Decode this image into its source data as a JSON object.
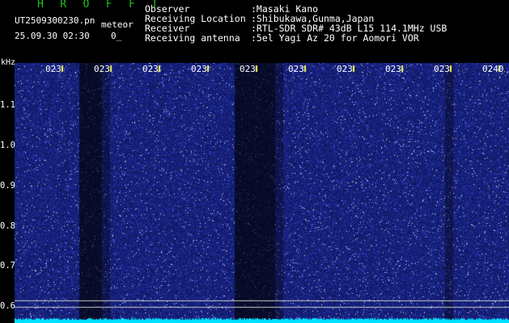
{
  "header": {
    "title": "H R O F F T",
    "file_name": "UT2509300230.pn",
    "meteor_label": "meteor",
    "datetime": "25.09.30 02:30",
    "count": "0_"
  },
  "info": [
    {
      "label": "Observer",
      "value": ":Masaki Kano"
    },
    {
      "label": "Receiving Location",
      "value": ":Shibukawa,Gunma,Japan"
    },
    {
      "label": "Receiver",
      "value": ":RTL-SDR SDR# 43dB L15 114.1MHz USB"
    },
    {
      "label": "Receiving antenna",
      "value": ":5el Yagi Az 20 for Aomori VOR"
    }
  ],
  "axis": {
    "unit": "kHz",
    "y_ticks": [
      "1.1",
      "1.0",
      "0.9",
      "0.8",
      "0.7",
      "0.6"
    ],
    "x_ticks": [
      "023",
      "023",
      "023",
      "023",
      "023",
      "023",
      "023",
      "023",
      "023",
      "0240"
    ]
  },
  "colors": {
    "title": "#22c322",
    "text": "#ffffff",
    "label": "#ffffff",
    "noise_bg": "#101c7a",
    "dark_band": "#07092e",
    "baseline": "#00e0ff",
    "grid_line": "#cccccc",
    "tick_mark": "#ffff55"
  }
}
